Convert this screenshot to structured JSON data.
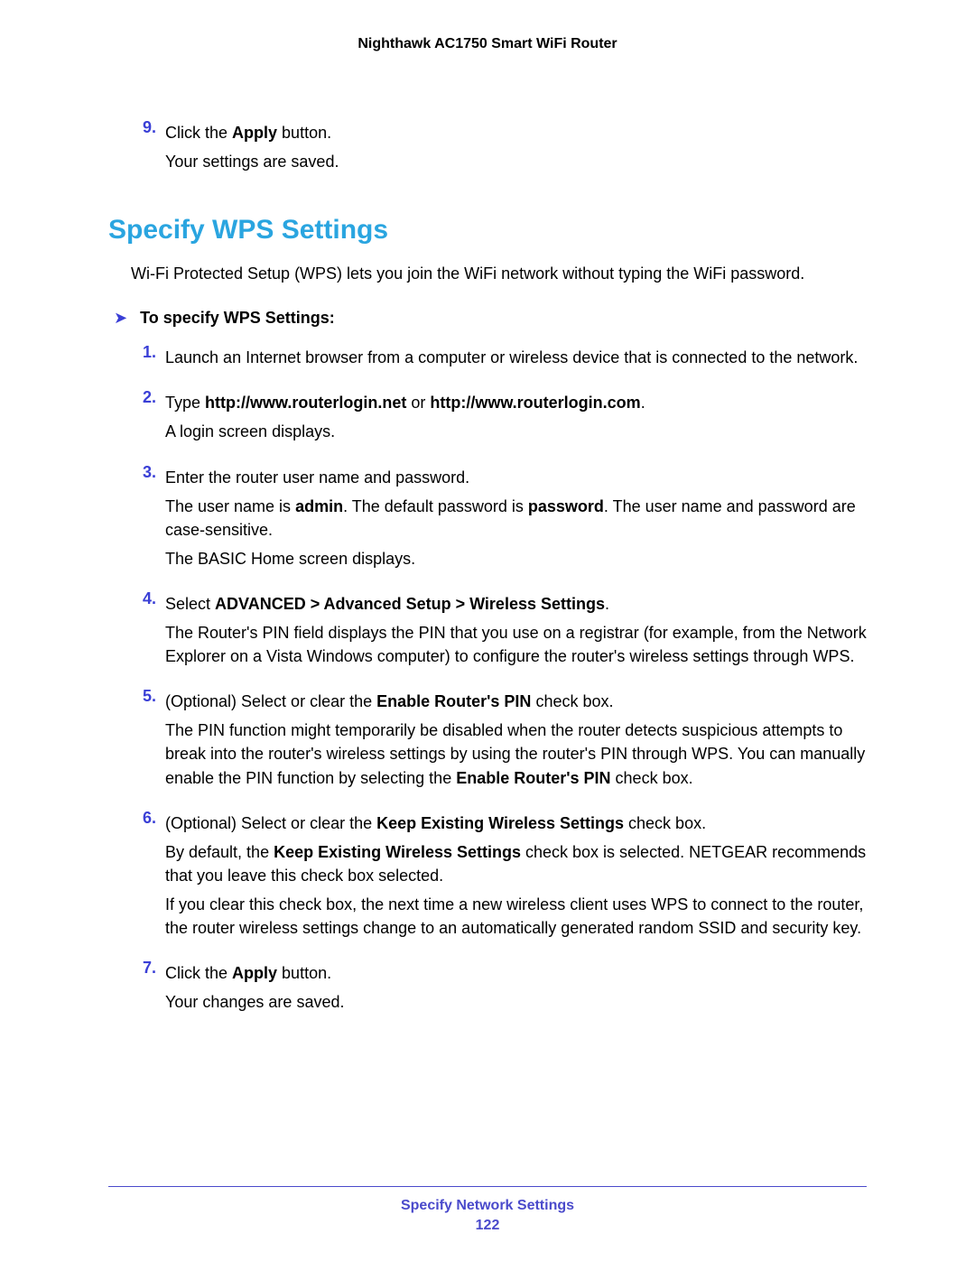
{
  "header": {
    "title": "Nighthawk AC1750 Smart WiFi Router"
  },
  "top_step": {
    "num": "9.",
    "line1_prefix": "Click the ",
    "line1_bold": "Apply",
    "line1_suffix": " button.",
    "line2": "Your settings are saved."
  },
  "section": {
    "title": "Specify WPS Settings",
    "intro": "Wi-Fi Protected Setup (WPS) lets you join the WiFi network without typing the WiFi password.",
    "subhead": "To specify WPS Settings:"
  },
  "steps": {
    "s1": {
      "num": "1.",
      "text": "Launch an Internet browser from a computer or wireless device that is connected to the network."
    },
    "s2": {
      "num": "2.",
      "prefix": "Type ",
      "bold1": "http://www.routerlogin.net",
      "mid": " or ",
      "bold2": "http://www.routerlogin.com",
      "suffix": ".",
      "p2": "A login screen displays."
    },
    "s3": {
      "num": "3.",
      "p1": "Enter the router user name and password.",
      "p2_prefix": "The user name is ",
      "p2_b1": "admin",
      "p2_mid": ". The default password is ",
      "p2_b2": "password",
      "p2_suffix": ". The user name and password are case-sensitive.",
      "p3": "The BASIC Home screen displays."
    },
    "s4": {
      "num": "4.",
      "prefix": "Select ",
      "bold": "ADVANCED > Advanced Setup > Wireless Settings",
      "suffix": ".",
      "p2": "The Router's PIN field displays the PIN that you use on a registrar (for example, from the Network Explorer on a Vista Windows computer) to configure the router's wireless settings through WPS."
    },
    "s5": {
      "num": "5.",
      "prefix": "(Optional) Select or clear the ",
      "bold": "Enable Router's PIN",
      "suffix": " check box.",
      "p2_prefix": "The PIN function might temporarily be disabled when the router detects suspicious attempts to break into the router's wireless settings by using the router's PIN through WPS. You can manually enable the PIN function by selecting the ",
      "p2_bold": "Enable Router's PIN",
      "p2_suffix": " check box."
    },
    "s6": {
      "num": "6.",
      "prefix": "(Optional) Select or clear the ",
      "bold": "Keep Existing Wireless Settings",
      "suffix": " check box.",
      "p2_prefix": "By default, the ",
      "p2_bold": "Keep Existing Wireless Settings",
      "p2_suffix": " check box is selected. NETGEAR recommends that you leave this check box selected.",
      "p3": "If you clear this check box, the next time a new wireless client uses WPS to connect to the router, the router wireless settings change to an automatically generated random SSID and security key."
    },
    "s7": {
      "num": "7.",
      "prefix": "Click the ",
      "bold": "Apply",
      "suffix": " button.",
      "p2": "Your changes are saved."
    }
  },
  "footer": {
    "section": "Specify Network Settings",
    "page": "122"
  }
}
